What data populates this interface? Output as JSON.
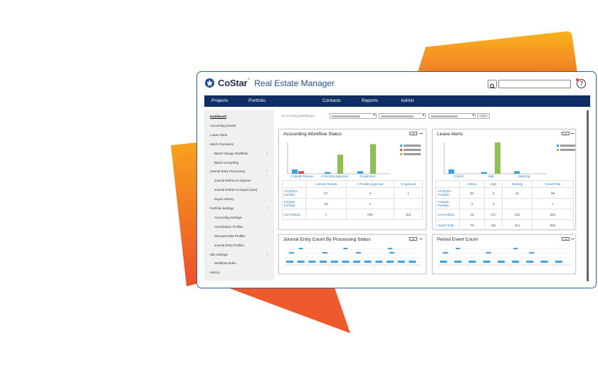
{
  "app": {
    "brand": "CoStar",
    "brand_tm": "™",
    "title": "Real Estate Manager",
    "help_label": "?"
  },
  "nav": {
    "items": [
      "Projects",
      "Portfolio",
      "Accounting",
      "Contacts",
      "Reports",
      "Admin"
    ],
    "active": "Accounting"
  },
  "sidebar": {
    "items": [
      {
        "label": "Dashboard",
        "active": true
      },
      {
        "label": "Accounting Events"
      },
      {
        "label": "Lease Alerts"
      },
      {
        "label": "Batch Processes"
      },
      {
        "label": "Batch Change Workflow",
        "sub": true,
        "caret": true
      },
      {
        "label": "Batch Accounting",
        "sub": true
      },
      {
        "label": "Journal Entry Processing",
        "caret": true
      },
      {
        "label": "Journal Entries to Approve",
        "sub": true
      },
      {
        "label": "Journal Entries to Export (new)",
        "sub": true
      },
      {
        "label": "Export History",
        "sub": true
      },
      {
        "label": "Portfolio Settings",
        "caret": true
      },
      {
        "label": "Accounting Settings",
        "sub": true
      },
      {
        "label": "Amortization Profiles",
        "sub": true
      },
      {
        "label": "Discount Rate Profiles",
        "sub": true
      },
      {
        "label": "Journal Entry Profiles",
        "sub": true
      },
      {
        "label": "Site Settings",
        "caret": true
      },
      {
        "label": "Workflow Rules",
        "sub": true
      },
      {
        "label": "History"
      }
    ]
  },
  "filter": {
    "label": "Accounting Dashboard",
    "apply_label": "Apply"
  },
  "workflow_card": {
    "title": "Accounting Workflow Status",
    "menu_label": "•••",
    "columns": [
      "1 Needs Review",
      "2 Pending approval",
      "3 Approved"
    ],
    "rows": [
      {
        "label": "All Others Portfolio",
        "values": [
          "67",
          "2",
          "1"
        ]
      },
      {
        "label": "Canada Portfolio",
        "values": [
          "28",
          "1",
          ""
        ]
      },
      {
        "label": "US Portfolio",
        "values": [
          "7",
          "293",
          "450"
        ]
      }
    ],
    "chart_data": {
      "type": "bar",
      "categories": [
        "1 Needs Review",
        "2 Pending approval",
        "3 Approved"
      ],
      "series": [
        {
          "color": "#3fa1dd",
          "values": [
            5,
            2,
            3
          ]
        },
        {
          "color": "#e0493b",
          "values": [
            3,
            0,
            0
          ]
        },
        {
          "color": "#8cc152",
          "values": [
            0,
            22,
            34
          ]
        }
      ]
    }
  },
  "lease_card": {
    "title": "Lease Alerts",
    "menu_label": "•••",
    "columns": [
      "Critical",
      "High",
      "Warning",
      "Grand Total"
    ],
    "rows": [
      {
        "label": "All Others Portfolio",
        "values": [
          "55",
          "3",
          "31",
          "98"
        ]
      },
      {
        "label": "Canada Portfolio",
        "values": [
          "4",
          "3",
          "",
          "7"
        ]
      },
      {
        "label": "US Portfolio",
        "values": [
          "18",
          "417",
          "120",
          "555"
        ]
      },
      {
        "label": "Grand Total",
        "values": [
          "78",
          "431",
          "151",
          "660"
        ]
      }
    ],
    "chart_data": {
      "type": "bar",
      "categories": [
        "Critical",
        "High",
        "Warning"
      ],
      "series": [
        {
          "color": "#3fa1dd",
          "values": [
            5,
            2,
            3
          ]
        },
        {
          "color": "#8cc152",
          "values": [
            0,
            36,
            0
          ]
        }
      ]
    }
  },
  "journal_card": {
    "title": "Journal Entry Count By Processing Status",
    "menu_label": "•••"
  },
  "period_card": {
    "title": "Period Event Count",
    "menu_label": "•••"
  },
  "colors": {
    "nav_bg": "#0f2e63",
    "accent_orange": "#ee6a2a",
    "bar_blue": "#3fa1dd",
    "bar_red": "#e0493b",
    "bar_green": "#8cc152",
    "link_blue": "#2f7fc1"
  }
}
